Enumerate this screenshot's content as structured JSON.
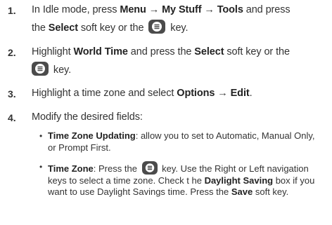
{
  "steps": [
    {
      "number": "1.",
      "parts": [
        "In Idle mode, press ",
        "Menu",
        " → ",
        "My Stuff",
        " → ",
        "Tools",
        " and press",
        "the ",
        "Select",
        " soft key or the ",
        " key."
      ]
    },
    {
      "number": "2.",
      "parts": [
        "Highlight ",
        "World Time",
        " and press the ",
        "Select",
        " soft key or the",
        " key."
      ]
    },
    {
      "number": "3.",
      "parts": [
        "Highlight a time zone and select ",
        "Options",
        " → ",
        "Edit",
        "."
      ]
    },
    {
      "number": "4.",
      "parts": [
        "Modify the desired fields:"
      ]
    }
  ],
  "bullets": [
    {
      "symbol": "•",
      "parts": [
        "Time Zone Updating",
        ": allow you to set to Automatic, Manual Only,",
        "or Prompt First."
      ]
    },
    {
      "symbol": "•",
      "parts": [
        "Time Zone",
        ": Press the ",
        " key. Use the Right or Left navigation",
        "keys to select a time zone. Check t he ",
        "Daylight Saving",
        " box if you",
        "want to use Daylight Savings time. Press the ",
        "Save",
        " soft key."
      ]
    }
  ],
  "icons": {
    "select_key": "select-key-icon"
  },
  "colors": {
    "key_bg": "#4b4b4b",
    "text": "#333333"
  }
}
